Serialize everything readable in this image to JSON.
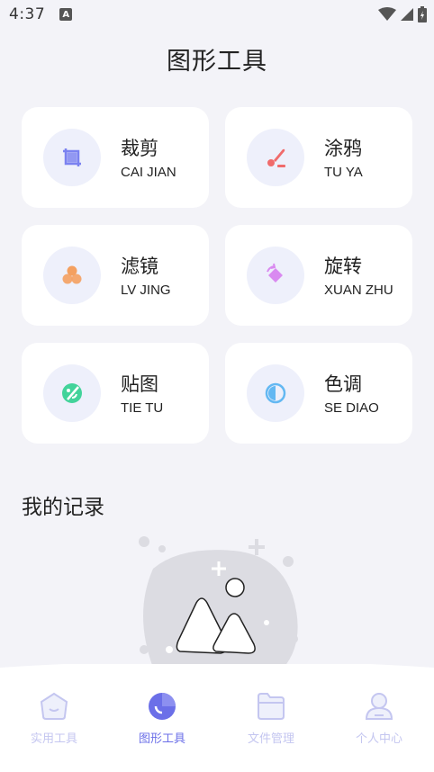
{
  "status": {
    "time": "4:37",
    "badge": "A"
  },
  "header": {
    "title": "图形工具"
  },
  "tools": [
    {
      "cn": "裁剪",
      "en": "CAI JIAN",
      "icon": "crop-icon",
      "color": "#7b82f0"
    },
    {
      "cn": "涂鸦",
      "en": "TU YA",
      "icon": "brush-icon",
      "color": "#f06b6b"
    },
    {
      "cn": "滤镜",
      "en": "LV JING",
      "icon": "filter-icon",
      "color": "#f4a060"
    },
    {
      "cn": "旋转",
      "en": "XUAN ZHU",
      "icon": "rotate-icon",
      "color": "#d98af0"
    },
    {
      "cn": "贴图",
      "en": "TIE TU",
      "icon": "sticker-icon",
      "color": "#42d39a"
    },
    {
      "cn": "色调",
      "en": "SE DIAO",
      "icon": "tone-icon",
      "color": "#63b8f2"
    }
  ],
  "records": {
    "title": "我的记录"
  },
  "nav": {
    "items": [
      {
        "label": "实用工具",
        "icon": "home-icon"
      },
      {
        "label": "图形工具",
        "icon": "pie-chart-icon",
        "active": true
      },
      {
        "label": "文件管理",
        "icon": "folder-icon"
      },
      {
        "label": "个人中心",
        "icon": "user-icon"
      }
    ],
    "active_color": "#6b6fe8",
    "inactive_color": "#c4c6f0"
  }
}
